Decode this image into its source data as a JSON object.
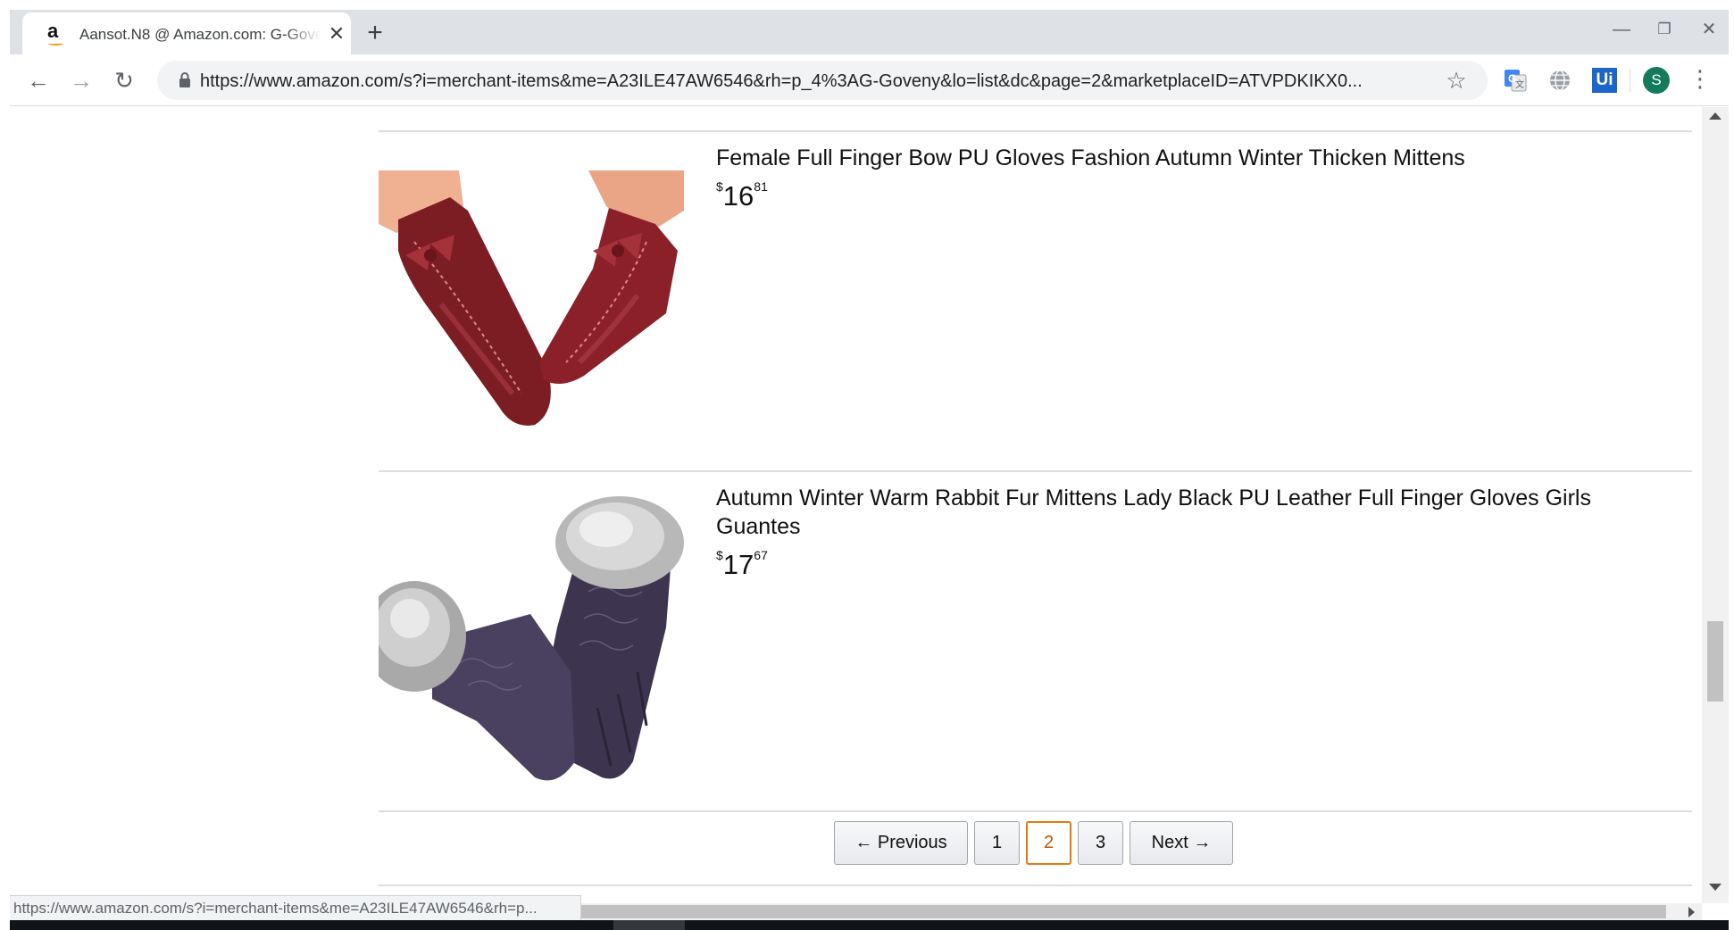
{
  "browser": {
    "tab": {
      "favicon_letter": "a",
      "title": "Aansot.N8 @ Amazon.com: G-Goveny",
      "close_glyph": "✕"
    },
    "new_tab_glyph": "+",
    "window_controls": {
      "minimize": "—",
      "restore": "❐",
      "close": "✕"
    },
    "nav": {
      "back": "←",
      "forward": "→",
      "reload": "↻"
    },
    "url": "https://www.amazon.com/s?i=merchant-items&me=A23ILE47AW6546&rh=p_4%3AG-Goveny&lo=list&dc&page=2&marketplaceID=ATVPDKIKX0...",
    "bookmark_glyph": "☆",
    "extensions": [
      "google-translate-icon",
      "globe-icon",
      "uipath-icon"
    ],
    "uipath_label": "Ui",
    "profile_initial": "S",
    "menu_glyph": "⋮",
    "colors": {
      "tabstrip": "#dee1e6",
      "omnibox": "#f1f3f4",
      "profile": "#137a5b"
    }
  },
  "results": [
    {
      "title": "Female Full Finger Bow PU Gloves Fashion Autumn Winter Thicken Mittens",
      "price": {
        "symbol": "$",
        "whole": "16",
        "fraction": "81"
      },
      "image": "red-leather-gloves-with-bow"
    },
    {
      "title": "Autumn Winter Warm Rabbit Fur Mittens Lady Black PU Leather Full Finger Gloves Girls Guantes",
      "price": {
        "symbol": "$",
        "whole": "17",
        "fraction": "67"
      },
      "image": "purple-leather-gloves-with-fur-cuffs"
    }
  ],
  "pagination": {
    "previous": "←   Previous",
    "pages": [
      "1",
      "2",
      "3"
    ],
    "current": "2",
    "next": "Next   →",
    "accent_color": "#e47911"
  },
  "status_bar": {
    "link_preview": "https://www.amazon.com/s?i=merchant-items&me=A23ILE47AW6546&rh=p..."
  }
}
